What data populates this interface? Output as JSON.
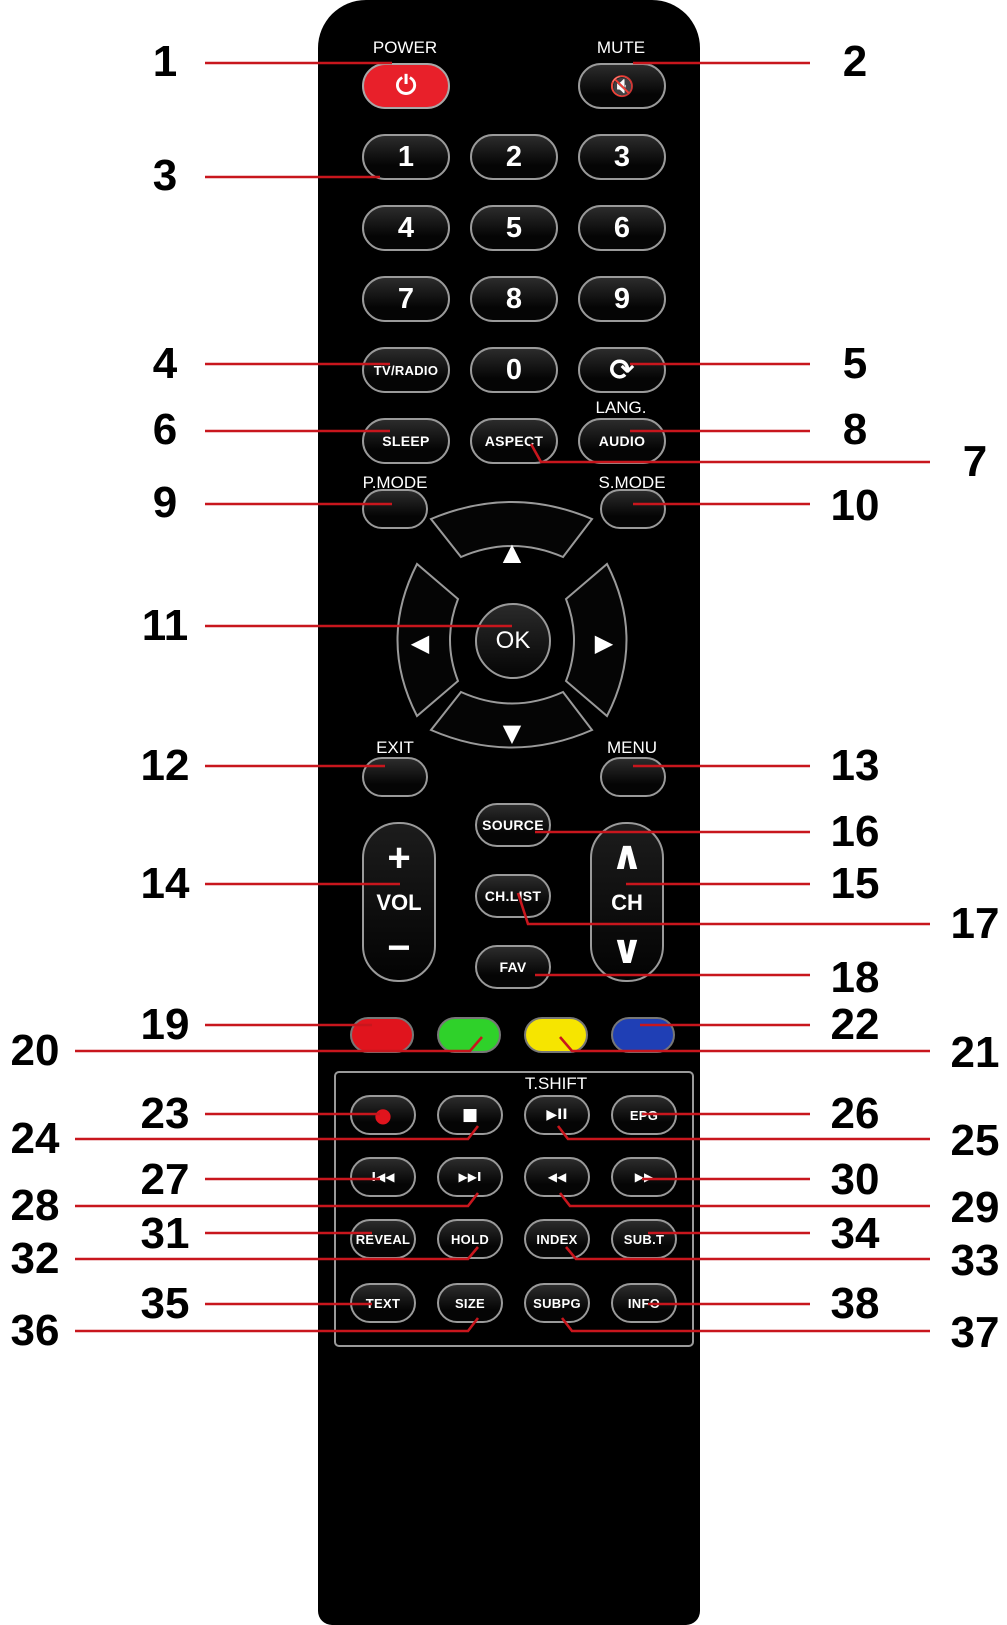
{
  "colors": {
    "remote_body": "#000000",
    "leader_line": "#c8161d",
    "power_button": "#e8202a",
    "red_key": "#e0141d",
    "green_key": "#2fd12a",
    "yellow_key": "#f6e500",
    "blue_key": "#1f3fb5"
  },
  "labels_above": {
    "power": "POWER",
    "mute": "MUTE",
    "lang": "LANG.",
    "pmode": "P.MODE",
    "smode": "S.MODE",
    "exit": "EXIT",
    "menu": "MENU",
    "tshift": "T.SHIFT"
  },
  "buttons": {
    "power_icon": "⏻",
    "mute_icon": "🔇",
    "digits": [
      "1",
      "2",
      "3",
      "4",
      "5",
      "6",
      "7",
      "8",
      "9",
      "0"
    ],
    "tv_radio": "TV/RADIO",
    "recall_icon": "⟳",
    "sleep": "SLEEP",
    "aspect": "ASPECT",
    "audio": "AUDIO",
    "ok": "OK",
    "arrow_up": "▲",
    "arrow_down": "▼",
    "arrow_left": "◀",
    "arrow_right": "▶",
    "source": "SOURCE",
    "ch_list": "CH.LIST",
    "fav": "FAV",
    "vol": "VOL",
    "vol_plus": "+",
    "vol_minus": "−",
    "ch": "CH",
    "ch_up": "∧",
    "ch_down": "∨",
    "record_icon": "●",
    "stop_icon": "■",
    "play_pause_icon": "▶II",
    "epg": "EPG",
    "prev_icon": "I◀◀",
    "next_icon": "▶▶I",
    "rewind_icon": "◀◀",
    "fast_forward_icon": "▶▶",
    "reveal": "REVEAL",
    "hold": "HOLD",
    "index": "INDEX",
    "sub_t": "SUB.T",
    "text": "TEXT",
    "size": "SIZE",
    "subpg": "SUBPG",
    "info": "INFO"
  },
  "callouts": [
    "1",
    "2",
    "3",
    "4",
    "5",
    "6",
    "7",
    "8",
    "9",
    "10",
    "11",
    "12",
    "13",
    "14",
    "15",
    "16",
    "17",
    "18",
    "19",
    "20",
    "21",
    "22",
    "23",
    "24",
    "25",
    "26",
    "27",
    "28",
    "29",
    "30",
    "31",
    "32",
    "33",
    "34",
    "35",
    "36",
    "37",
    "38"
  ]
}
